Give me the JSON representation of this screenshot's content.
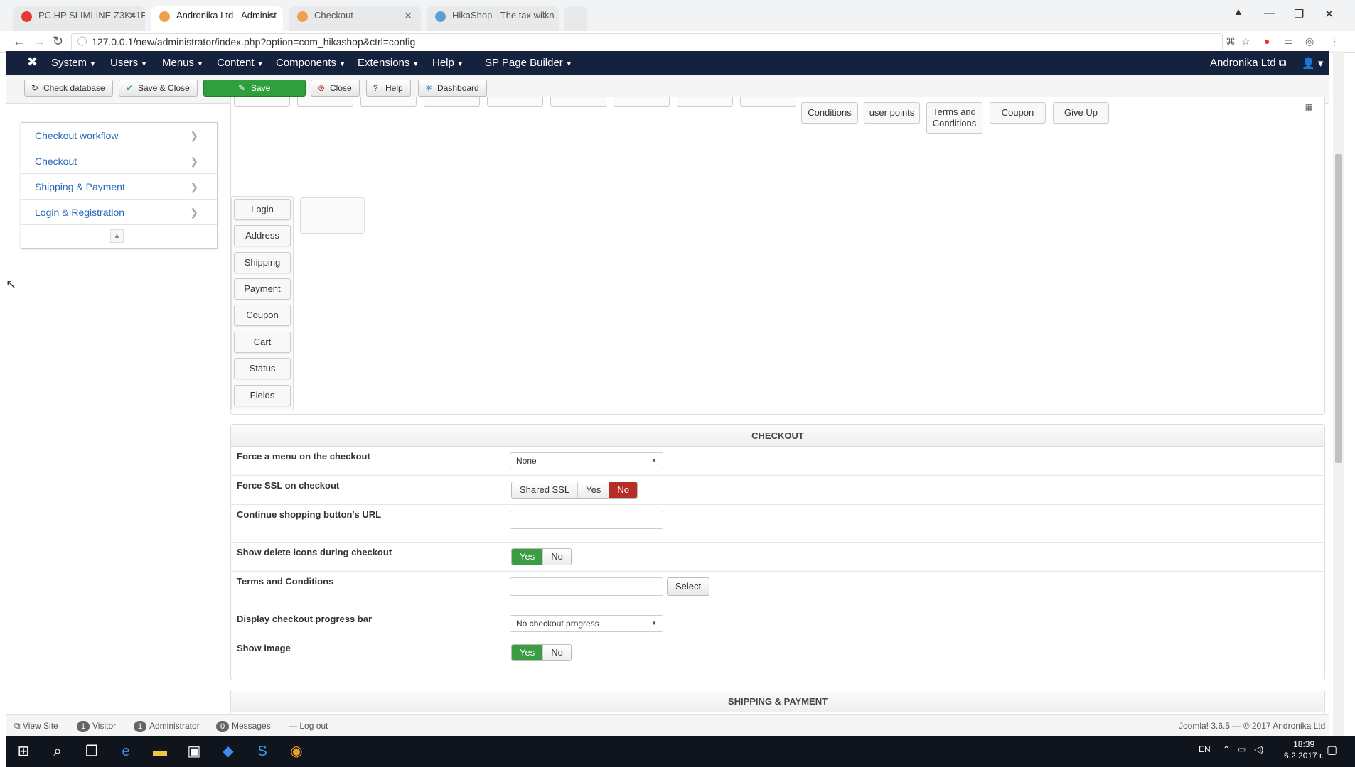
{
  "browser": {
    "tabs": [
      {
        "title": "PC HP SLIMLINE Z3K41E",
        "active": false
      },
      {
        "title": "Andronika Ltd - Administ",
        "active": true
      },
      {
        "title": "Checkout",
        "active": false
      },
      {
        "title": "HikaShop - The tax will n",
        "active": false
      }
    ],
    "url": "127.0.0.1/new/administrator/index.php?option=com_hikashop&ctrl=config"
  },
  "nav": {
    "menus": [
      "System",
      "Users",
      "Menus",
      "Content",
      "Components",
      "Extensions",
      "Help",
      "SP Page Builder"
    ],
    "site_name": "Andronika Ltd"
  },
  "toolbar": {
    "check_db": "Check database",
    "save_close": "Save & Close",
    "save": "Save",
    "close": "Close",
    "help": "Help",
    "dashboard": "Dashboard"
  },
  "sidebar": {
    "items": [
      {
        "label": "Checkout workflow"
      },
      {
        "label": "Checkout"
      },
      {
        "label": "Shipping & Payment"
      },
      {
        "label": "Login & Registration"
      }
    ]
  },
  "workflow": {
    "top_buttons": [
      "Conditions",
      "user points",
      "Terms and Conditions",
      "Coupon",
      "Give Up"
    ],
    "components": [
      "Login",
      "Address",
      "Shipping",
      "Payment",
      "Coupon",
      "Cart",
      "Status",
      "Fields"
    ]
  },
  "checkout": {
    "title": "CHECKOUT",
    "force_menu_label": "Force a menu on the checkout",
    "force_menu_value": "None",
    "force_ssl_label": "Force SSL on checkout",
    "ssl_shared": "Shared SSL",
    "ssl_yes": "Yes",
    "ssl_no": "No",
    "continue_url_label": "Continue shopping button's URL",
    "continue_url_value": "",
    "delete_icons_label": "Show delete icons during checkout",
    "yes": "Yes",
    "no": "No",
    "terms_label": "Terms and Conditions",
    "terms_value": "",
    "select_btn": "Select",
    "progress_label": "Display checkout progress bar",
    "progress_value": "No checkout progress",
    "show_image_label": "Show image"
  },
  "shipping_payment": {
    "title": "SHIPPING & PAYMENT"
  },
  "statusbar": {
    "view_site": "View Site",
    "visitor_count": "1",
    "visitor": "Visitor",
    "admin_count": "1",
    "admin": "Administrator",
    "messages_count": "0",
    "messages": "Messages",
    "logout": "Log out",
    "copyright": "Joomla! 3.6.5 — © 2017 Andronika Ltd"
  },
  "taskbar": {
    "lang": "EN",
    "time": "18:39",
    "date": "6.2.2017 г."
  },
  "colors": {
    "nav_bg": "#15223d",
    "save_green": "#2f9e3d",
    "toggle_red": "#b42f28",
    "toggle_green": "#3a9c43",
    "link_blue": "#2a69b8"
  }
}
